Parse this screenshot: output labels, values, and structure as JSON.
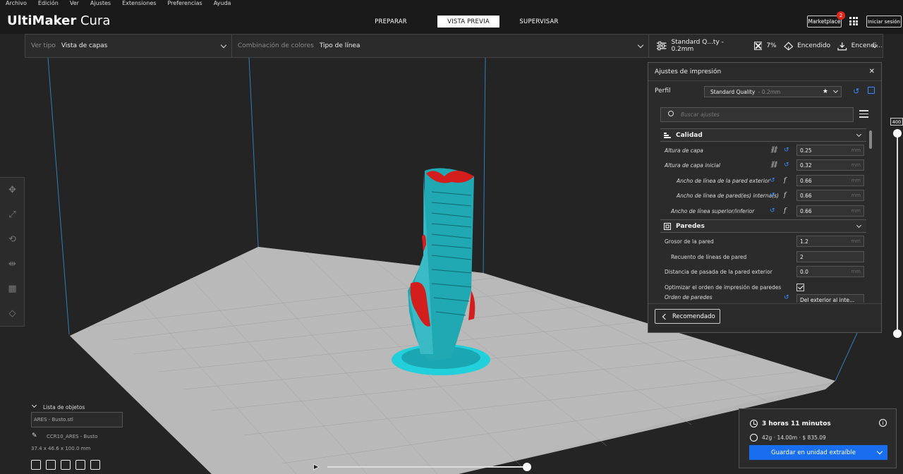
{
  "menu": [
    "Archivo",
    "Edición",
    "Ver",
    "Ajustes",
    "Extensiones",
    "Preferencias",
    "Ayuda"
  ],
  "header": {
    "logo_bold": "UltiMaker",
    "logo_light": "Cura",
    "stages": [
      "PREPARAR",
      "VISTA PREVIA",
      "SUPERVISAR"
    ],
    "active_stage": "VISTA PREVIA",
    "marketplace": "Marketplace",
    "marketplace_badge": "2",
    "signin": "Iniciar sesión"
  },
  "toolbar": {
    "view_type_label": "Ver tipo",
    "view_type_value": "Vista de capas",
    "color_scheme_label": "Combinación de colores",
    "color_scheme_value": "Tipo de línea",
    "profile": "Standard Q...ty - 0.2mm",
    "infill": "7%",
    "support": "Encendido",
    "adhesion": "Encendi..."
  },
  "panel": {
    "title": "Ajustes de impresión",
    "profile_label": "Perfil",
    "profile_value": "Standard Quality",
    "profile_sub": "- 0.2mm",
    "search_placeholder": "Buscar ajustes",
    "categories": {
      "quality": "Calidad",
      "walls": "Paredes"
    },
    "quality_rows": [
      {
        "label": "Altura de capa",
        "value": "0.25",
        "unit": "mm"
      },
      {
        "label": "Altura de capa inicial",
        "value": "0.32",
        "unit": "mm"
      },
      {
        "label": "Ancho de línea de la pared exterior",
        "value": "0.66",
        "unit": "mm"
      },
      {
        "label": "Ancho de línea de pared(es) interna(s)",
        "value": "0.66",
        "unit": "mm"
      },
      {
        "label": "Ancho de línea superior/inferior",
        "value": "0.66",
        "unit": "mm"
      }
    ],
    "wall_rows": [
      {
        "label": "Grosor de la pared",
        "value": "1.2",
        "unit": "mm"
      },
      {
        "label": "Recuento de líneas de pared",
        "value": "2",
        "unit": ""
      },
      {
        "label": "Distancia de pasada de la pared exterior",
        "value": "0.0",
        "unit": "mm"
      },
      {
        "label": "Optimizar el orden de impresión de paredes",
        "value": "",
        "unit": ""
      },
      {
        "label": "Orden de paredes",
        "value": "Del exterior al inte...",
        "unit": ""
      }
    ],
    "recommended": "Recomendado"
  },
  "layer_slider": {
    "value": "400"
  },
  "objects": {
    "header": "Lista de objetos",
    "file": "ARES - Busto.stl",
    "name": "CCR10_ARES - Busto",
    "dims": "37.4 x 46.6 x 100.0 mm"
  },
  "print_info": {
    "time": "3 horas 11 minutos",
    "material": "42g · 14.00m · $ 835.09",
    "save": "Guardar en unidad extraíble"
  },
  "colors": {
    "accent": "#196ef0",
    "bg": "#242424",
    "model_teal": "#29b3bf",
    "skin_red": "#d41e1e"
  }
}
